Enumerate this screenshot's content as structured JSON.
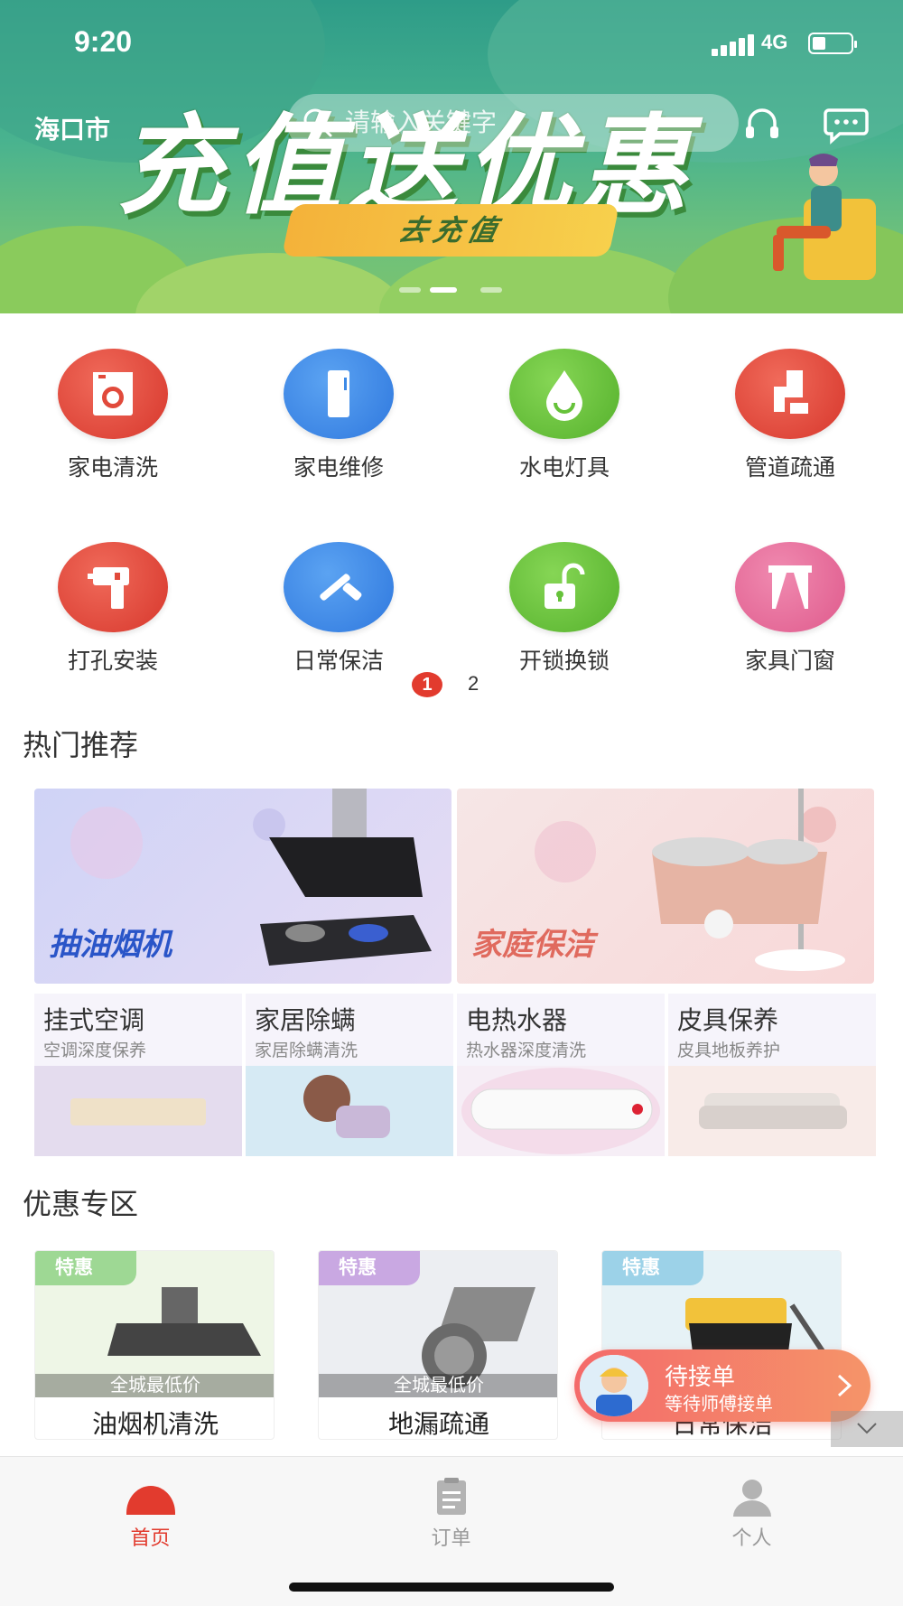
{
  "status_bar": {
    "time": "9:20",
    "network": "4G"
  },
  "header": {
    "city": "海口市",
    "search_placeholder": "请输入关键字"
  },
  "banner": {
    "title": "充值送优惠",
    "button": "去充值",
    "active_dot": 2,
    "dot_count": 3
  },
  "categories": [
    {
      "label": "家电清洗",
      "icon": "washing-machine-icon",
      "color": "#e74a3c"
    },
    {
      "label": "家电维修",
      "icon": "refrigerator-icon",
      "color": "#3d8ae6"
    },
    {
      "label": "水电灯具",
      "icon": "water-drop-icon",
      "color": "#66c23a"
    },
    {
      "label": "管道疏通",
      "icon": "pipe-icon",
      "color": "#e74a3c"
    },
    {
      "label": "打孔安装",
      "icon": "drill-icon",
      "color": "#e74a3c"
    },
    {
      "label": "日常保洁",
      "icon": "squeegee-icon",
      "color": "#3d8ae6"
    },
    {
      "label": "开锁换锁",
      "icon": "unlock-icon",
      "color": "#66c23a"
    },
    {
      "label": "家具门窗",
      "icon": "curtain-icon",
      "color": "#e8669a"
    }
  ],
  "category_pager": {
    "current": "1",
    "next": "2"
  },
  "hot": {
    "title": "热门推荐",
    "big": [
      {
        "caption": "抽油烟机",
        "bg": "#dcd6f4"
      },
      {
        "caption": "家庭保洁",
        "bg": "#f6dadc"
      }
    ],
    "small": [
      {
        "title": "挂式空调",
        "subtitle": "空调深度保养"
      },
      {
        "title": "家居除螨",
        "subtitle": "家居除螨清洗"
      },
      {
        "title": "电热水器",
        "subtitle": "热水器深度清洗"
      },
      {
        "title": "皮具保养",
        "subtitle": "皮具地板养护"
      }
    ]
  },
  "deals": {
    "title": "优惠专区",
    "items": [
      {
        "tag": "特惠",
        "badge": "全城最低价",
        "name": "油烟机清洗"
      },
      {
        "tag": "特惠",
        "badge": "全城最低价",
        "name": "地漏疏通"
      },
      {
        "tag": "特惠",
        "badge": "",
        "name": "日常保洁"
      }
    ]
  },
  "pending_order": {
    "title": "待接单",
    "subtitle": "等待师傅接单"
  },
  "tabbar": {
    "items": [
      {
        "label": "首页",
        "active": true
      },
      {
        "label": "订单",
        "active": false
      },
      {
        "label": "个人",
        "active": false
      }
    ],
    "active_color": "#e23b2e",
    "inactive_color": "#999999"
  }
}
